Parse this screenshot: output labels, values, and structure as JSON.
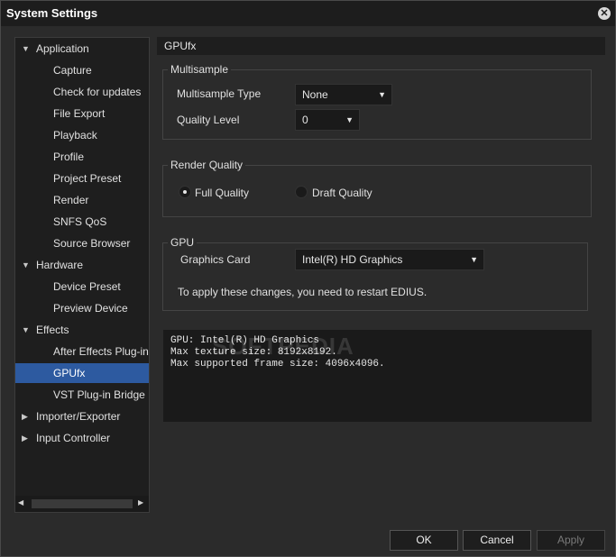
{
  "window": {
    "title": "System Settings"
  },
  "tree": {
    "nodes": [
      {
        "label": "Application",
        "level": 0,
        "arrow": "▼"
      },
      {
        "label": "Capture",
        "level": 1
      },
      {
        "label": "Check for updates",
        "level": 1
      },
      {
        "label": "File Export",
        "level": 1
      },
      {
        "label": "Playback",
        "level": 1
      },
      {
        "label": "Profile",
        "level": 1
      },
      {
        "label": "Project Preset",
        "level": 1
      },
      {
        "label": "Render",
        "level": 1
      },
      {
        "label": "SNFS QoS",
        "level": 1
      },
      {
        "label": "Source Browser",
        "level": 1
      },
      {
        "label": "Hardware",
        "level": 0,
        "arrow": "▼"
      },
      {
        "label": "Device Preset",
        "level": 1
      },
      {
        "label": "Preview Device",
        "level": 1
      },
      {
        "label": "Effects",
        "level": 0,
        "arrow": "▼"
      },
      {
        "label": "After Effects Plug-in Bridge",
        "level": 1
      },
      {
        "label": "GPUfx",
        "level": 1,
        "selected": true
      },
      {
        "label": "VST Plug-in Bridge",
        "level": 1
      },
      {
        "label": "Importer/Exporter",
        "level": 0,
        "arrow": "▶"
      },
      {
        "label": "Input Controller",
        "level": 0,
        "arrow": "▶"
      }
    ],
    "scroll_left": "◀",
    "scroll_right": "▶"
  },
  "panel": {
    "title": "GPUfx",
    "multisample": {
      "title": "Multisample",
      "type_label": "Multisample Type",
      "type_value": "None",
      "quality_label": "Quality Level",
      "quality_value": "0"
    },
    "render_quality": {
      "title": "Render Quality",
      "full": "Full Quality",
      "draft": "Draft Quality",
      "selected": "full"
    },
    "gpu": {
      "title": "GPU",
      "card_label": "Graphics Card",
      "card_value": "Intel(R) HD Graphics",
      "restart_note": "To apply these changes, you need to restart EDIUS."
    },
    "info": {
      "line1": "GPU: Intel(R) HD Graphics",
      "line2": "Max texture size: 8192x8192.",
      "line3": "Max supported frame size: 4096x4096."
    },
    "watermark": "SOFTPEDIA"
  },
  "buttons": {
    "ok": "OK",
    "cancel": "Cancel",
    "apply": "Apply"
  },
  "colors": {
    "selection": "#2d5aa0",
    "background": "#2b2b2b",
    "panel_dark": "#1a1a1a"
  },
  "icons": {
    "close": "close-icon",
    "dropdown": "chevron-down-icon",
    "expand": "triangle-icon"
  }
}
